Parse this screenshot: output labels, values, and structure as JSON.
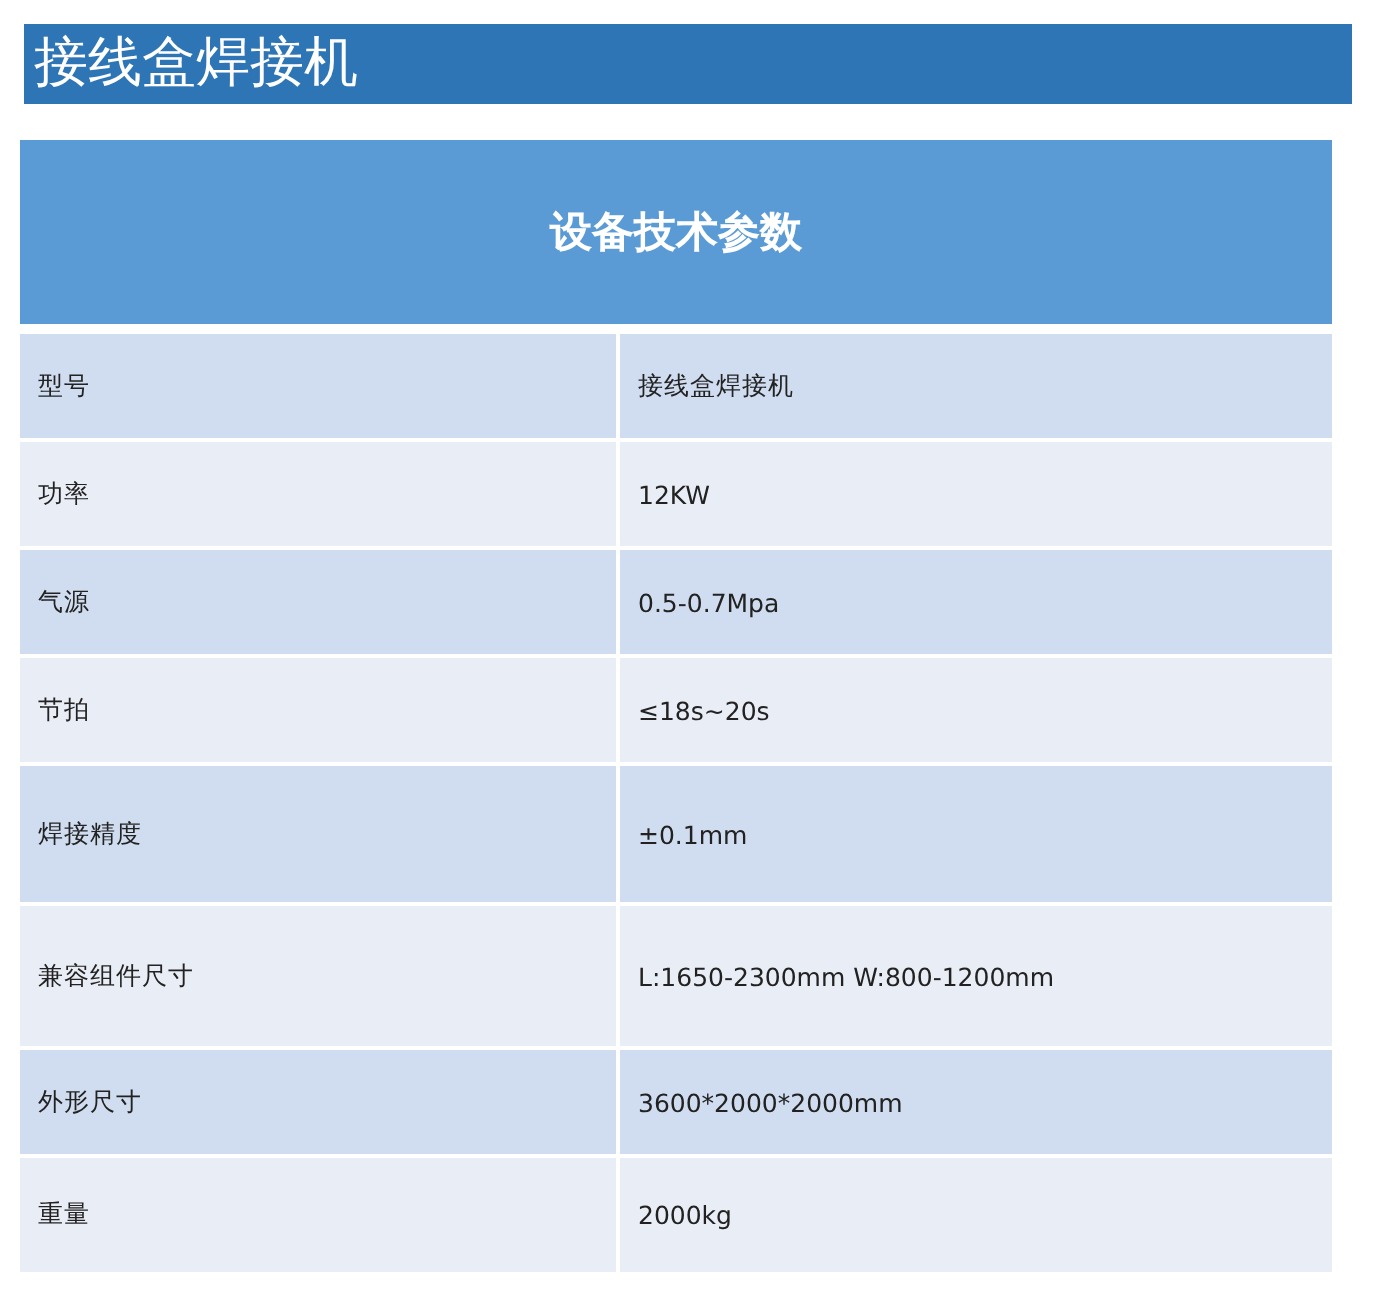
{
  "title": "接线盒焊接机",
  "table": {
    "heading": "设备技术参数",
    "rows": [
      {
        "label": "型号",
        "value": "接线盒焊接机"
      },
      {
        "label": "功率",
        "value": "12KW"
      },
      {
        "label": "气源",
        "value": "0.5-0.7Mpa"
      },
      {
        "label": "节拍",
        "value": "≤18s~20s"
      },
      {
        "label": "焊接精度",
        "value": "±0.1mm"
      },
      {
        "label": "兼容组件尺寸",
        "value": "L:1650-2300mm W:800-1200mm"
      },
      {
        "label": "外形尺寸",
        "value": "3600*2000*2000mm"
      },
      {
        "label": "重量",
        "value": "2000kg"
      }
    ]
  }
}
